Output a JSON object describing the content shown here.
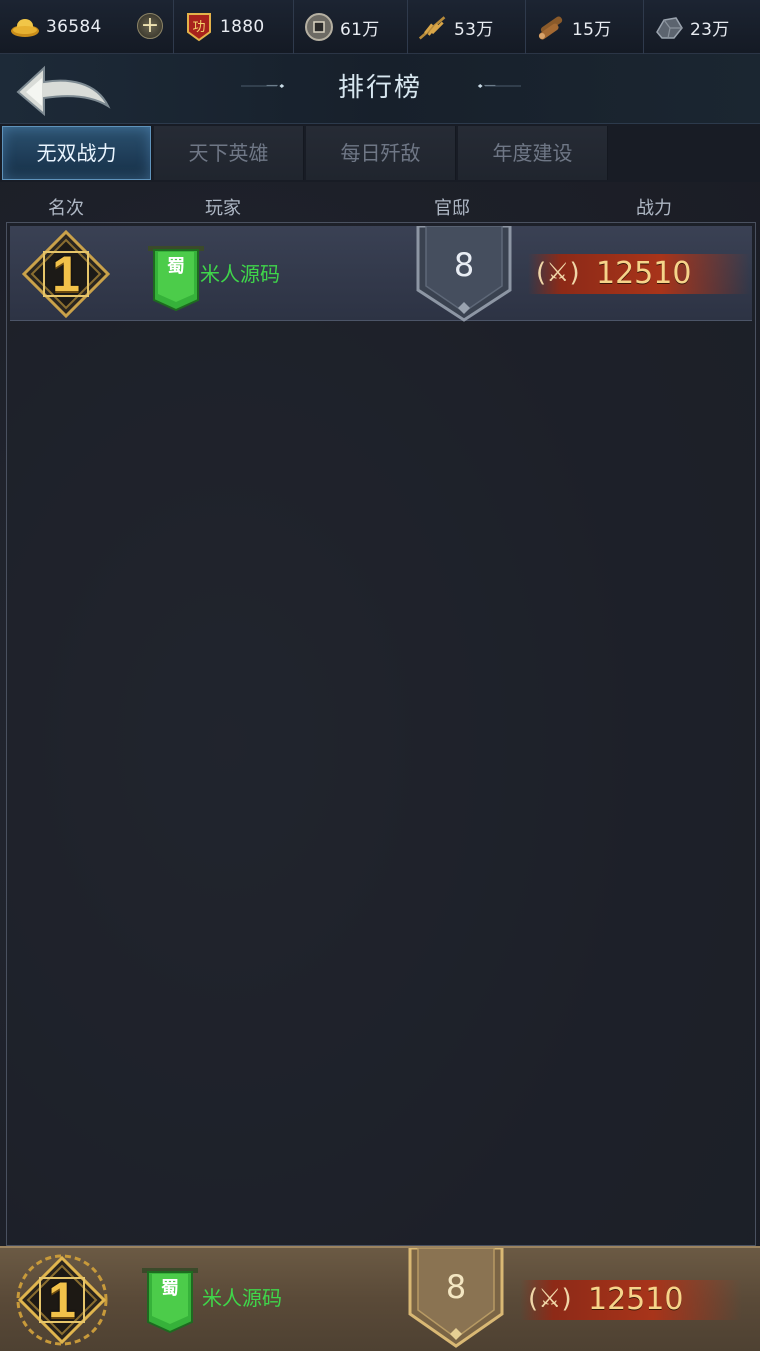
{
  "resources": [
    {
      "id": "gold",
      "icon": "gold-ingot-icon",
      "value": "36584",
      "has_plus": true
    },
    {
      "id": "merit",
      "icon": "merit-badge-icon",
      "badge_char": "功",
      "value": "1880"
    },
    {
      "id": "coin",
      "icon": "copper-coin-icon",
      "value": "61万"
    },
    {
      "id": "grain",
      "icon": "wheat-icon",
      "value": "53万"
    },
    {
      "id": "wood",
      "icon": "wood-logs-icon",
      "value": "15万"
    },
    {
      "id": "iron",
      "icon": "iron-ore-icon",
      "value": "23万"
    }
  ],
  "header": {
    "title": "排行榜",
    "back_icon": "back-arrow-icon"
  },
  "tabs": [
    {
      "label": "无双战力",
      "active": true
    },
    {
      "label": "天下英雄",
      "active": false
    },
    {
      "label": "每日歼敌",
      "active": false
    },
    {
      "label": "年度建设",
      "active": false
    }
  ],
  "columns": {
    "rank": "名次",
    "player": "玩家",
    "mansion": "官邸",
    "power": "战力"
  },
  "rows": [
    {
      "rank": "1",
      "faction": "蜀",
      "name": "米人源码",
      "mansion": "8",
      "power": "12510"
    }
  ],
  "self": {
    "rank": "1",
    "faction": "蜀",
    "name": "米人源码",
    "mansion": "8",
    "power": "12510"
  },
  "colors": {
    "accent_tab": "#1e3c57",
    "player_name": "#3fd64a",
    "rank_gold": "#f2c24a",
    "power_bar": "#a8341a"
  }
}
